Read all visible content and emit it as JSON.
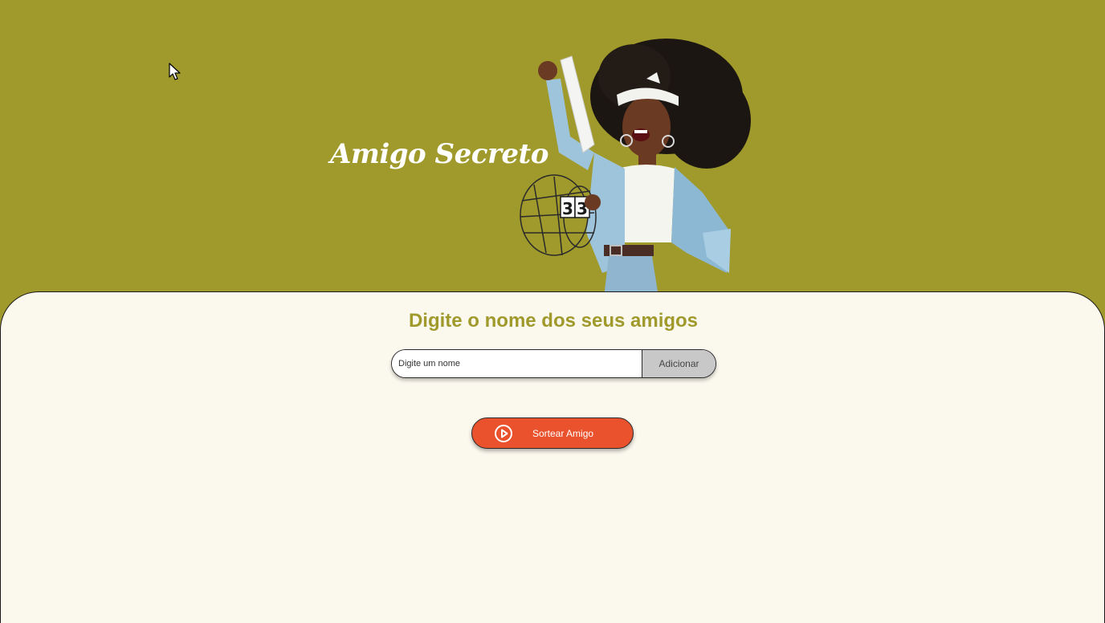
{
  "header": {
    "title": "Amigo Secreto",
    "illustration_icon": "woman-holding-raffle-ticket-illustration"
  },
  "main": {
    "heading": "Digite o nome dos seus amigos",
    "name_input": {
      "placeholder": "Digite um nome",
      "value": ""
    },
    "add_button_label": "Adicionar",
    "draw_button_label": "Sortear Amigo",
    "draw_button_icon": "play-circle-icon"
  },
  "colors": {
    "background": "#a09a2c",
    "panel": "#fbf8ee",
    "heading": "#a09a2c",
    "draw_button": "#e9522c",
    "add_button": "#c8c8c8"
  }
}
